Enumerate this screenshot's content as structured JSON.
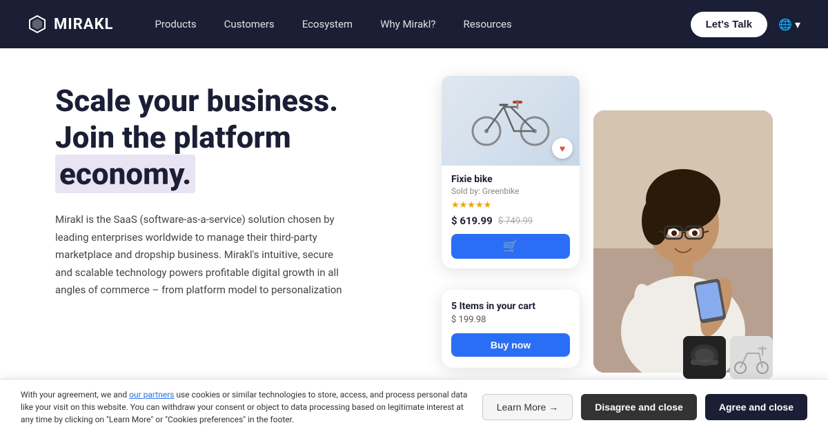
{
  "navbar": {
    "logo_text": "MIRAKL",
    "nav_items": [
      {
        "label": "Products"
      },
      {
        "label": "Customers"
      },
      {
        "label": "Ecosystem"
      },
      {
        "label": "Why Mirakl?"
      },
      {
        "label": "Resources"
      }
    ],
    "cta_button": "Let's Talk",
    "globe_icon": "🌐"
  },
  "hero": {
    "title_line1": "Scale your business.",
    "title_line2": "Join the platform",
    "title_line3": "economy.",
    "description": "Mirakl is the SaaS (software-as-a-service) solution chosen by leading enterprises worldwide to manage their third-party marketplace and dropship business. Mirakl's intuitive, secure and scalable technology powers profitable digital growth in all angles of commerce – from platform model to personalization"
  },
  "product_card": {
    "product_name": "Fixie bike",
    "seller": "Sold by: Greenbike",
    "stars": "★★★★★",
    "price_current": "$ 619.99",
    "price_original": "$ 749.99",
    "cart_icon": "🛒",
    "heart_icon": "♥"
  },
  "cart_card": {
    "title": "5 Items in your cart",
    "price": "$ 199.98",
    "buy_label": "Buy now"
  },
  "cookie_banner": {
    "text_before_link": "With your agreement, we and ",
    "link_text": "our partners",
    "text_after_link": " use cookies or similar technologies to store, access, and process personal data like your visit on this website. You can withdraw your consent or object to data processing based on legitimate interest at any time by clicking on \"Learn More\" or \"Cookies preferences\" in the footer.",
    "btn_learn_more": "Learn More →",
    "btn_disagree": "Disagree and close",
    "btn_agree": "Agree and close"
  }
}
